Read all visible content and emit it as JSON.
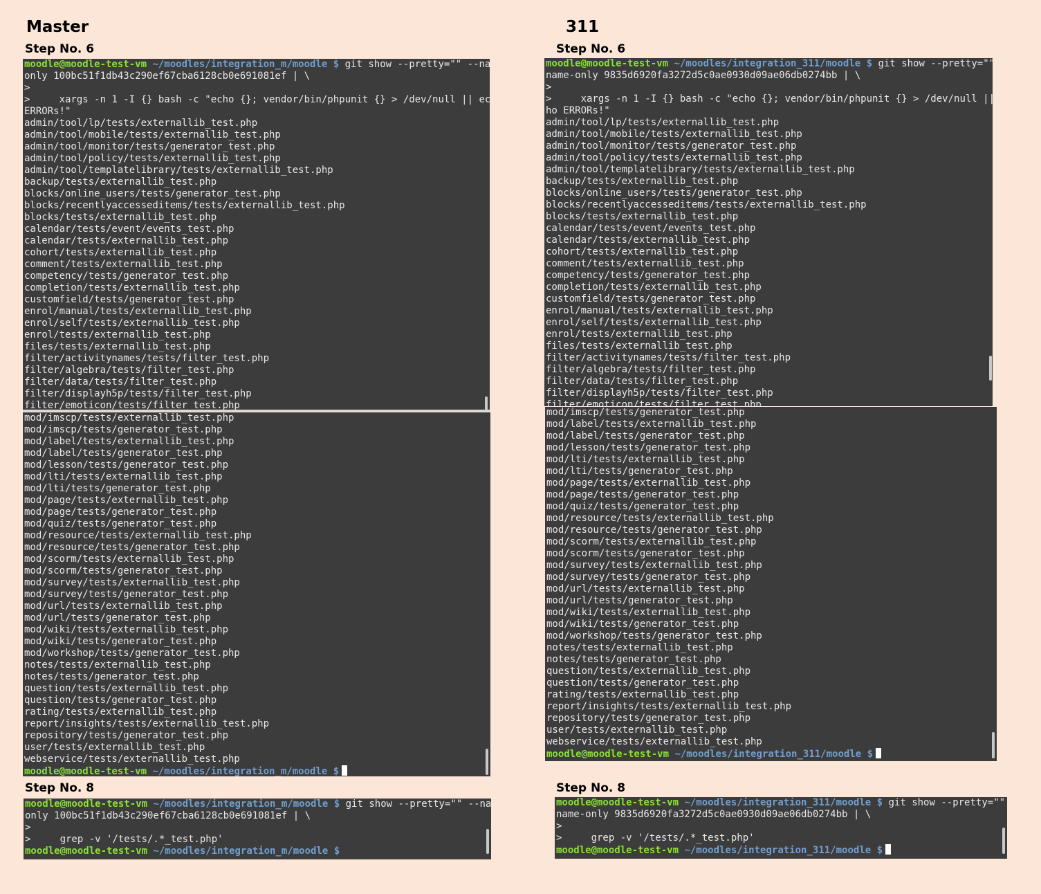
{
  "left": {
    "title": "Master",
    "step6_label": "Step No. 6",
    "step8_label": "Step No. 8",
    "prompt": {
      "user": "moodle@moodle-test-vm",
      "path": "~/moodles/integration_m/moodle",
      "dollar": "$"
    },
    "step6_cmd_first": " git show --pretty=\"\" --name-",
    "step6_cmd_rest": [
      "only 100bc51f1db43c290ef67cba6128cb0e691081ef | \\",
      ">",
      ">     xargs -n 1 -I {} bash -c \"echo {}; vendor/bin/phpunit {} > /dev/null || echo",
      "ERRORs!\""
    ],
    "step6_top_files": [
      "admin/tool/lp/tests/externallib_test.php",
      "admin/tool/mobile/tests/externallib_test.php",
      "admin/tool/monitor/tests/generator_test.php",
      "admin/tool/policy/tests/externallib_test.php",
      "admin/tool/templatelibrary/tests/externallib_test.php",
      "backup/tests/externallib_test.php",
      "blocks/online_users/tests/generator_test.php",
      "blocks/recentlyaccesseditems/tests/externallib_test.php",
      "blocks/tests/externallib_test.php",
      "calendar/tests/event/events_test.php",
      "calendar/tests/externallib_test.php",
      "cohort/tests/externallib_test.php",
      "comment/tests/externallib_test.php",
      "competency/tests/generator_test.php",
      "completion/tests/externallib_test.php",
      "customfield/tests/generator_test.php",
      "enrol/manual/tests/externallib_test.php",
      "enrol/self/tests/externallib_test.php",
      "enrol/tests/externallib_test.php",
      "files/tests/externallib_test.php",
      "filter/activitynames/tests/filter_test.php",
      "filter/algebra/tests/filter_test.php",
      "filter/data/tests/filter_test.php",
      "filter/displayh5p/tests/filter_test.php",
      "filter/emoticon/tests/filter_test.php"
    ],
    "step6_bottom_files": [
      "mod/imscp/tests/externallib_test.php",
      "mod/imscp/tests/generator_test.php",
      "mod/label/tests/externallib_test.php",
      "mod/label/tests/generator_test.php",
      "mod/lesson/tests/generator_test.php",
      "mod/lti/tests/externallib_test.php",
      "mod/lti/tests/generator_test.php",
      "mod/page/tests/externallib_test.php",
      "mod/page/tests/generator_test.php",
      "mod/quiz/tests/generator_test.php",
      "mod/resource/tests/externallib_test.php",
      "mod/resource/tests/generator_test.php",
      "mod/scorm/tests/externallib_test.php",
      "mod/scorm/tests/generator_test.php",
      "mod/survey/tests/externallib_test.php",
      "mod/survey/tests/generator_test.php",
      "mod/url/tests/externallib_test.php",
      "mod/url/tests/generator_test.php",
      "mod/wiki/tests/externallib_test.php",
      "mod/wiki/tests/generator_test.php",
      "mod/workshop/tests/generator_test.php",
      "notes/tests/externallib_test.php",
      "notes/tests/generator_test.php",
      "question/tests/externallib_test.php",
      "question/tests/generator_test.php",
      "rating/tests/externallib_test.php",
      "report/insights/tests/externallib_test.php",
      "repository/tests/generator_test.php",
      "user/tests/externallib_test.php",
      "webservice/tests/externallib_test.php"
    ],
    "step8_cmd_first": " git show --pretty=\"\" --name-",
    "step8_cmd_rest": [
      "only 100bc51f1db43c290ef67cba6128cb0e691081ef | \\",
      ">",
      ">     grep -v '/tests/.*_test.php'"
    ]
  },
  "right": {
    "title": "311",
    "step6_label": "Step No. 6",
    "step8_label": "Step No. 8",
    "prompt": {
      "user": "moodle@moodle-test-vm",
      "path": "~/moodles/integration_311/moodle",
      "dollar": "$"
    },
    "step6_cmd_first": " git show --pretty=\"\" --",
    "step6_cmd_rest": [
      "name-only 9835d6920fa3272d5c0ae0930d09ae06db0274bb | \\",
      ">",
      ">     xargs -n 1 -I {} bash -c \"echo {}; vendor/bin/phpunit {} > /dev/null || ec",
      "ho ERRORs!\""
    ],
    "step6_top_files": [
      "admin/tool/lp/tests/externallib_test.php",
      "admin/tool/mobile/tests/externallib_test.php",
      "admin/tool/monitor/tests/generator_test.php",
      "admin/tool/policy/tests/externallib_test.php",
      "admin/tool/templatelibrary/tests/externallib_test.php",
      "backup/tests/externallib_test.php",
      "blocks/online_users/tests/generator_test.php",
      "blocks/recentlyaccesseditems/tests/externallib_test.php",
      "blocks/tests/externallib_test.php",
      "calendar/tests/event/events_test.php",
      "calendar/tests/externallib_test.php",
      "cohort/tests/externallib_test.php",
      "comment/tests/externallib_test.php",
      "competency/tests/generator_test.php",
      "completion/tests/externallib_test.php",
      "customfield/tests/generator_test.php",
      "enrol/manual/tests/externallib_test.php",
      "enrol/self/tests/externallib_test.php",
      "enrol/tests/externallib_test.php",
      "files/tests/externallib_test.php",
      "filter/activitynames/tests/filter_test.php",
      "filter/algebra/tests/filter_test.php",
      "filter/data/tests/filter_test.php",
      "filter/displayh5p/tests/filter_test.php",
      "filter/emoticon/tests/filter_test.php"
    ],
    "step6_bottom_files": [
      "mod/imscp/tests/generator_test.php",
      "mod/label/tests/externallib_test.php",
      "mod/label/tests/generator_test.php",
      "mod/lesson/tests/generator_test.php",
      "mod/lti/tests/externallib_test.php",
      "mod/lti/tests/generator_test.php",
      "mod/page/tests/externallib_test.php",
      "mod/page/tests/generator_test.php",
      "mod/quiz/tests/generator_test.php",
      "mod/resource/tests/externallib_test.php",
      "mod/resource/tests/generator_test.php",
      "mod/scorm/tests/externallib_test.php",
      "mod/scorm/tests/generator_test.php",
      "mod/survey/tests/externallib_test.php",
      "mod/survey/tests/generator_test.php",
      "mod/url/tests/externallib_test.php",
      "mod/url/tests/generator_test.php",
      "mod/wiki/tests/externallib_test.php",
      "mod/wiki/tests/generator_test.php",
      "mod/workshop/tests/generator_test.php",
      "notes/tests/externallib_test.php",
      "notes/tests/generator_test.php",
      "question/tests/externallib_test.php",
      "question/tests/generator_test.php",
      "rating/tests/externallib_test.php",
      "report/insights/tests/externallib_test.php",
      "repository/tests/generator_test.php",
      "user/tests/externallib_test.php",
      "webservice/tests/externallib_test.php"
    ],
    "step8_cmd_first": " git show --pretty=\"\" --",
    "step8_cmd_rest": [
      "name-only 9835d6920fa3272d5c0ae0930d09ae06db0274bb | \\",
      ">",
      ">     grep -v '/tests/.*_test.php'"
    ]
  }
}
